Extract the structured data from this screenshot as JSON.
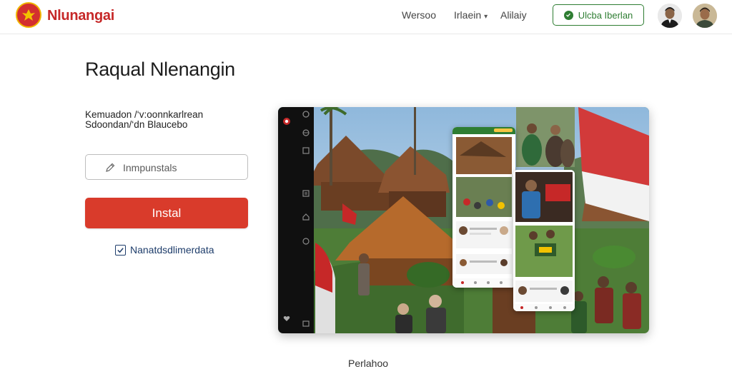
{
  "header": {
    "brand": "Nlunangai",
    "nav": [
      "Wersoo",
      "Irlaein",
      "Alilaiy"
    ],
    "cta_label": "Ulcba Iberlan"
  },
  "main": {
    "title": "Raqual Nlenangin",
    "subtitle_line1": "Kemuadon /‘v:oonnkarlrean",
    "subtitle_line2": "Sdoondan/‘dn Blaucebo",
    "input_placeholder": "Inmpunstals",
    "install_label": "Instal",
    "checkbox_label": "Nanatdsdlimerdata",
    "checkbox_checked": true,
    "footer_text": "Perlahoo"
  },
  "colors": {
    "brand_red": "#d93b2b",
    "cta_green": "#2e7d32",
    "checkbox_blue": "#1e3d6b"
  },
  "icons": [
    "logo-emblem-icon",
    "check-circle-icon",
    "pencil-icon",
    "checkbox-check-icon"
  ]
}
